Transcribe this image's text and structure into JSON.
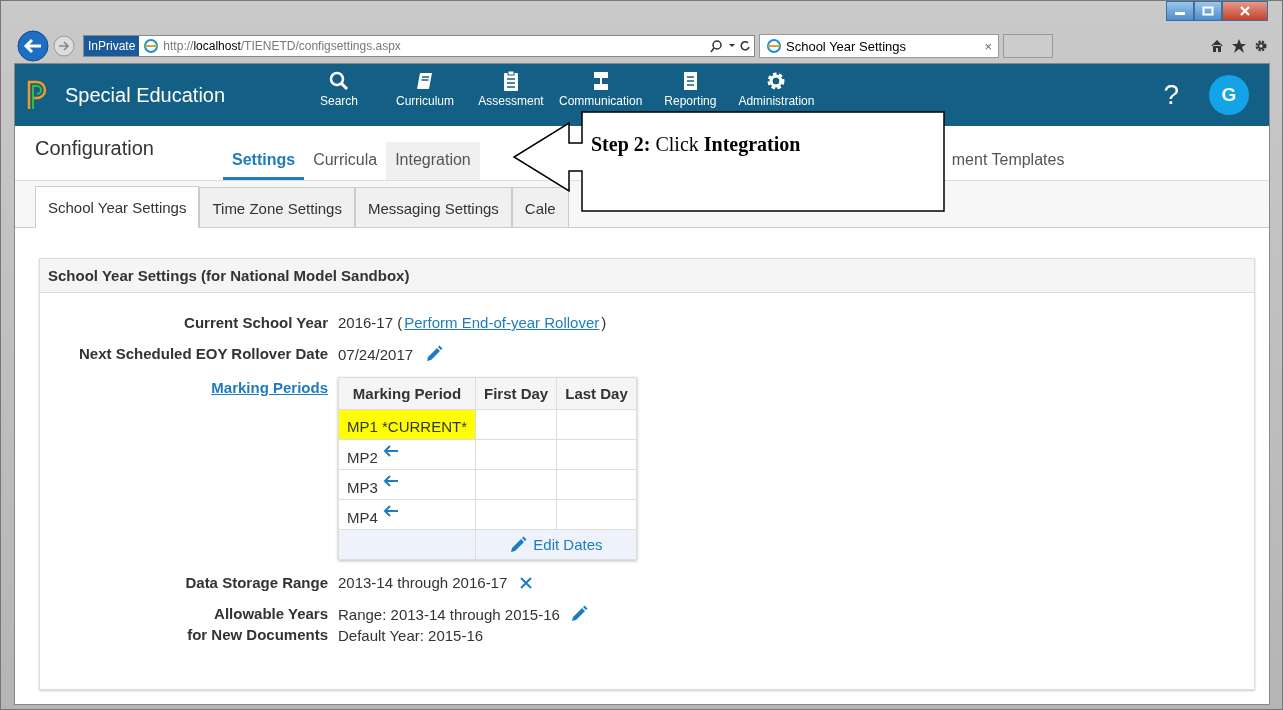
{
  "browser": {
    "badge": "InPrivate",
    "address": "http://**localhost**/TIENETD/configsettings.aspx",
    "tab_title": "School Year Settings",
    "tab_close": "×"
  },
  "app": {
    "title": "Special Education",
    "help": "?",
    "avatar": "G",
    "nav": [
      {
        "label": "Search",
        "kind": "search"
      },
      {
        "label": "Curriculum",
        "kind": "book"
      },
      {
        "label": "Assessment",
        "kind": "clipboard"
      },
      {
        "label": "Communication",
        "kind": "chart"
      },
      {
        "label": "Reporting",
        "kind": "document"
      },
      {
        "label": "Administration",
        "kind": "gear"
      }
    ]
  },
  "page": {
    "title": "Configuration",
    "tabs": [
      {
        "label": "Settings",
        "selected": true,
        "hovered": false
      },
      {
        "label": "Curricula",
        "selected": false,
        "hovered": false
      },
      {
        "label": "Integration",
        "selected": false,
        "hovered": true
      },
      {
        "label": "ment Templates",
        "selected": false,
        "hovered": false
      }
    ],
    "subtabs": [
      {
        "label": "School Year Settings",
        "selected": true
      },
      {
        "label": "Time Zone Settings",
        "selected": false
      },
      {
        "label": "Messaging Settings",
        "selected": false
      },
      {
        "label": "Cale",
        "selected": false
      }
    ]
  },
  "card": {
    "title": "School Year Settings (for National Model Sandbox)",
    "current_year": {
      "label": "Current School Year",
      "prefix": "2016-17 (",
      "link": "Perform End-of-year Rollover",
      "suffix": ")"
    },
    "rollover": {
      "label": "Next Scheduled EOY Rollover Date",
      "value": "07/24/2017",
      "kind": "editable"
    },
    "marking_periods": {
      "label": "Marking Periods",
      "columns": [
        "Marking Period",
        "First Day",
        "Last Day"
      ],
      "rows": [
        {
          "name": "MP1 *CURRENT*",
          "current": true
        },
        {
          "name": "MP2",
          "current": false
        },
        {
          "name": "MP3",
          "current": false
        },
        {
          "name": "MP4",
          "current": false
        }
      ],
      "footer": "Edit Dates"
    },
    "storage": {
      "label": "Data Storage Range",
      "value": "2013-14 through 2016-17",
      "kind": "clearable"
    },
    "allowable": {
      "label_lines": [
        "Allowable Years",
        "for New Documents"
      ],
      "lines": [
        "Range: 2013-14 through 2015-16",
        "Default Year: 2015-16"
      ],
      "kind": "editable"
    }
  },
  "callout": {
    "text": "**Step 2:** Click **Integration**"
  }
}
